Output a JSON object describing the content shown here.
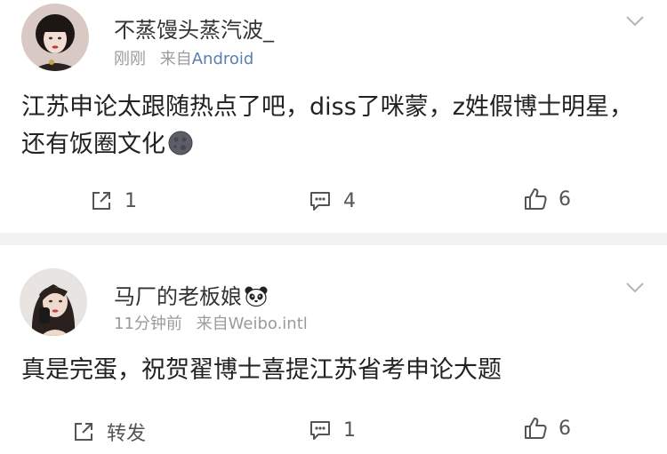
{
  "posts": [
    {
      "username": "不蒸馒头蒸汽波_",
      "time": "刚刚",
      "source_prefix": "来自",
      "source": "Android",
      "content": "江苏申论太跟随热点了吧，diss了咪蒙，z姓假博士明星，还有饭圈文化",
      "content_emoji": "moon-icon",
      "actions": {
        "repost": "1",
        "comment": "4",
        "like": "6"
      }
    },
    {
      "username": "马厂的老板娘",
      "username_emoji": "panda-icon",
      "time": "11分钟前",
      "source_prefix": "来自",
      "source": "Weibo.intl",
      "content": "真是完蛋，祝贺翟博士喜提江苏省考申论大题",
      "actions": {
        "repost": "转发",
        "comment": "1",
        "like": "6"
      }
    }
  ],
  "colors": {
    "text_primary": "#222222",
    "text_meta": "#9b9b9b",
    "source_link": "#5a7fb0",
    "separator": "#f2f2f2",
    "icon": "#555555"
  }
}
